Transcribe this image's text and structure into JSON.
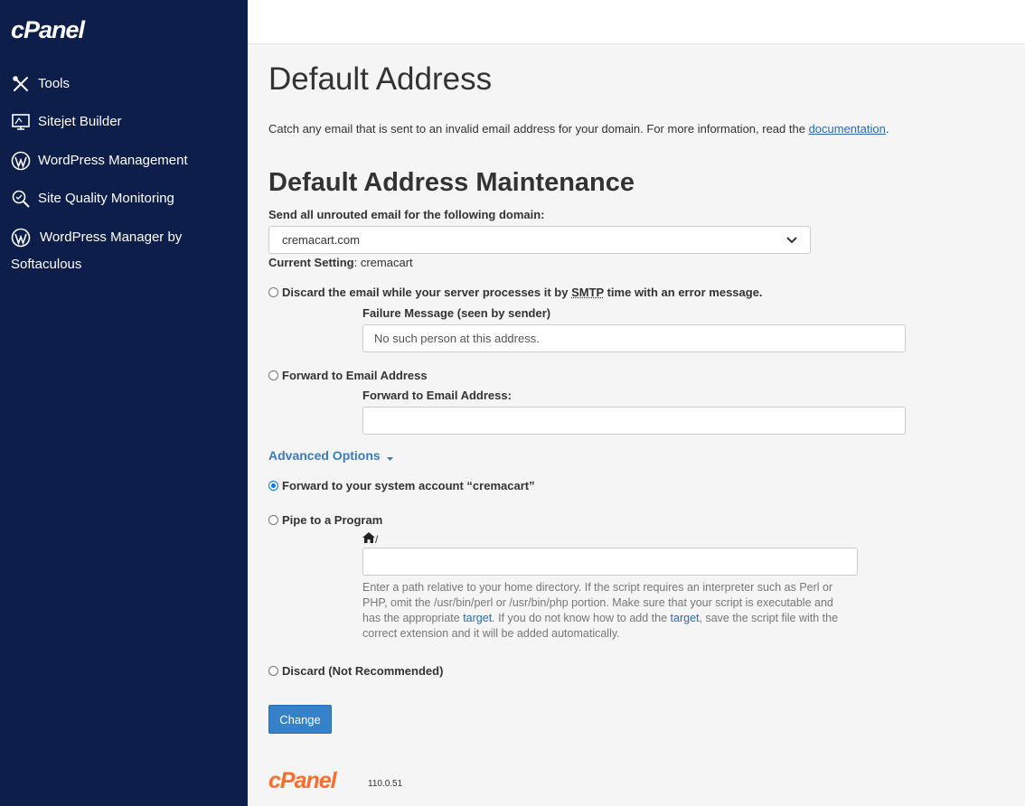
{
  "sidebar": {
    "logo": "cPanel",
    "items": [
      {
        "label": "Tools",
        "icon": "tools-icon"
      },
      {
        "label": "Sitejet Builder",
        "icon": "sitejet-icon"
      },
      {
        "label": "WordPress Management",
        "icon": "wordpress-icon"
      },
      {
        "label": "Site Quality Monitoring",
        "icon": "monitoring-icon"
      },
      {
        "label_line1": "WordPress Manager by",
        "label_line2": "Softaculous",
        "icon": "wordpress-icon"
      }
    ]
  },
  "main": {
    "title": "Default Address",
    "intro_text": "Catch any email that is sent to an invalid email address for your domain. For more information, read the ",
    "intro_link": "documentation",
    "intro_end": ".",
    "section_title": "Default Address Maintenance",
    "domain_label": "Send all unrouted email for the following domain:",
    "domain_value": "cremacart.com",
    "current_setting_label": "Current Setting",
    "current_setting_value": ": cremacart",
    "options": {
      "discard_error": {
        "label_pre": "Discard the email while your server processes it by ",
        "label_abbr": "SMTP",
        "label_post": " time with an error message.",
        "field_label": "Failure Message (seen by sender)",
        "field_value": "No such person at this address."
      },
      "forward_email": {
        "label": "Forward to Email Address",
        "field_label": "Forward to Email Address:",
        "field_value": ""
      },
      "advanced_label": "Advanced Options",
      "forward_system": {
        "label": "Forward to your system account “cremacart”",
        "checked": true
      },
      "pipe": {
        "label": "Pipe to a Program",
        "path_prefix": "/",
        "field_value": "",
        "help_1": "Enter a path relative to your home directory. If the script requires an interpreter such as Perl or PHP, omit the /usr/bin/perl or /usr/bin/php portion. Make sure that your script is executable and has the appropriate ",
        "help_link1": "target",
        "help_2": ". If you do not know how to add the ",
        "help_link2": "target",
        "help_3": ", save the script file with the correct extension and it will be added automatically."
      },
      "discard": {
        "label": "Discard (Not Recommended)"
      }
    },
    "change_button": "Change"
  },
  "footer": {
    "logo": "cPanel",
    "version": "110.0.51"
  },
  "colors": {
    "sidebar_bg": "#0d1e4b",
    "link": "#2a6bb0",
    "button": "#3582cb",
    "brand_orange": "#ff6c2c"
  }
}
